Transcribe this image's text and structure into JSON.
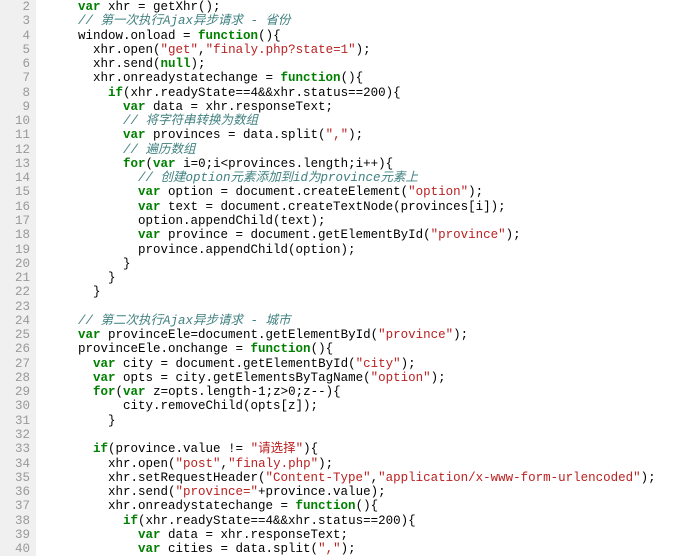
{
  "lines": [
    {
      "num": "2",
      "indent": 2,
      "tokens": [
        {
          "t": "var ",
          "c": "kw"
        },
        {
          "t": "xhr = getXhr();",
          "c": ""
        }
      ]
    },
    {
      "num": "3",
      "indent": 2,
      "tokens": [
        {
          "t": "// 第一次执行Ajax异步请求 - 省份",
          "c": "com"
        }
      ]
    },
    {
      "num": "4",
      "indent": 2,
      "tokens": [
        {
          "t": "window.onload = ",
          "c": ""
        },
        {
          "t": "function",
          "c": "kw"
        },
        {
          "t": "(){",
          "c": ""
        }
      ]
    },
    {
      "num": "5",
      "indent": 3,
      "tokens": [
        {
          "t": "xhr.open(",
          "c": ""
        },
        {
          "t": "\"get\"",
          "c": "str"
        },
        {
          "t": ",",
          "c": ""
        },
        {
          "t": "\"finaly.php?state=1\"",
          "c": "str"
        },
        {
          "t": ");",
          "c": ""
        }
      ]
    },
    {
      "num": "6",
      "indent": 3,
      "tokens": [
        {
          "t": "xhr.send(",
          "c": ""
        },
        {
          "t": "null",
          "c": "bool"
        },
        {
          "t": ");",
          "c": ""
        }
      ]
    },
    {
      "num": "7",
      "indent": 3,
      "tokens": [
        {
          "t": "xhr.onreadystatechange = ",
          "c": ""
        },
        {
          "t": "function",
          "c": "kw"
        },
        {
          "t": "(){",
          "c": ""
        }
      ]
    },
    {
      "num": "8",
      "indent": 4,
      "tokens": [
        {
          "t": "if",
          "c": "kw"
        },
        {
          "t": "(xhr.readyState==4&&xhr.status==200){",
          "c": ""
        }
      ]
    },
    {
      "num": "9",
      "indent": 5,
      "tokens": [
        {
          "t": "var ",
          "c": "kw"
        },
        {
          "t": "data = xhr.responseText;",
          "c": ""
        }
      ]
    },
    {
      "num": "10",
      "indent": 5,
      "tokens": [
        {
          "t": "// 将字符串转换为数组",
          "c": "com"
        }
      ]
    },
    {
      "num": "11",
      "indent": 5,
      "tokens": [
        {
          "t": "var ",
          "c": "kw"
        },
        {
          "t": "provinces = data.split(",
          "c": ""
        },
        {
          "t": "\",\"",
          "c": "str"
        },
        {
          "t": ");",
          "c": ""
        }
      ]
    },
    {
      "num": "12",
      "indent": 5,
      "tokens": [
        {
          "t": "// 遍历数组",
          "c": "com"
        }
      ]
    },
    {
      "num": "13",
      "indent": 5,
      "tokens": [
        {
          "t": "for",
          "c": "kw"
        },
        {
          "t": "(",
          "c": ""
        },
        {
          "t": "var ",
          "c": "kw"
        },
        {
          "t": "i=0;i<provinces.length;i++){",
          "c": ""
        }
      ]
    },
    {
      "num": "14",
      "indent": 6,
      "tokens": [
        {
          "t": "// 创建option元素添加到id为province元素上",
          "c": "com"
        }
      ]
    },
    {
      "num": "15",
      "indent": 6,
      "tokens": [
        {
          "t": "var ",
          "c": "kw"
        },
        {
          "t": "option = document.createElement(",
          "c": ""
        },
        {
          "t": "\"option\"",
          "c": "str"
        },
        {
          "t": ");",
          "c": ""
        }
      ]
    },
    {
      "num": "16",
      "indent": 6,
      "tokens": [
        {
          "t": "var ",
          "c": "kw"
        },
        {
          "t": "text = document.createTextNode(provinces[i]);",
          "c": ""
        }
      ]
    },
    {
      "num": "17",
      "indent": 6,
      "tokens": [
        {
          "t": "option.appendChild(text);",
          "c": ""
        }
      ]
    },
    {
      "num": "18",
      "indent": 6,
      "tokens": [
        {
          "t": "var ",
          "c": "kw"
        },
        {
          "t": "province = document.getElementById(",
          "c": ""
        },
        {
          "t": "\"province\"",
          "c": "str"
        },
        {
          "t": ");",
          "c": ""
        }
      ]
    },
    {
      "num": "19",
      "indent": 6,
      "tokens": [
        {
          "t": "province.appendChild(option);",
          "c": ""
        }
      ]
    },
    {
      "num": "20",
      "indent": 5,
      "tokens": [
        {
          "t": "}",
          "c": ""
        }
      ]
    },
    {
      "num": "21",
      "indent": 4,
      "tokens": [
        {
          "t": "}",
          "c": ""
        }
      ]
    },
    {
      "num": "22",
      "indent": 3,
      "tokens": [
        {
          "t": "}",
          "c": ""
        }
      ]
    },
    {
      "num": "23",
      "indent": 0,
      "tokens": []
    },
    {
      "num": "24",
      "indent": 2,
      "tokens": [
        {
          "t": "// 第二次执行Ajax异步请求 - 城市",
          "c": "com"
        }
      ]
    },
    {
      "num": "25",
      "indent": 2,
      "tokens": [
        {
          "t": "var ",
          "c": "kw"
        },
        {
          "t": "provinceEle=document.getElementById(",
          "c": ""
        },
        {
          "t": "\"province\"",
          "c": "str"
        },
        {
          "t": ");",
          "c": ""
        }
      ]
    },
    {
      "num": "26",
      "indent": 2,
      "tokens": [
        {
          "t": "provinceEle.onchange = ",
          "c": ""
        },
        {
          "t": "function",
          "c": "kw"
        },
        {
          "t": "(){",
          "c": ""
        }
      ]
    },
    {
      "num": "27",
      "indent": 3,
      "tokens": [
        {
          "t": "var ",
          "c": "kw"
        },
        {
          "t": "city = document.getElementById(",
          "c": ""
        },
        {
          "t": "\"city\"",
          "c": "str"
        },
        {
          "t": ");",
          "c": ""
        }
      ]
    },
    {
      "num": "28",
      "indent": 3,
      "tokens": [
        {
          "t": "var ",
          "c": "kw"
        },
        {
          "t": "opts = city.getElementsByTagName(",
          "c": ""
        },
        {
          "t": "\"option\"",
          "c": "str"
        },
        {
          "t": ");",
          "c": ""
        }
      ]
    },
    {
      "num": "29",
      "indent": 3,
      "tokens": [
        {
          "t": "for",
          "c": "kw"
        },
        {
          "t": "(",
          "c": ""
        },
        {
          "t": "var ",
          "c": "kw"
        },
        {
          "t": "z=opts.length-1;z>0;z--){",
          "c": ""
        }
      ]
    },
    {
      "num": "30",
      "indent": 5,
      "tokens": [
        {
          "t": "city.removeChild(opts[z]);",
          "c": ""
        }
      ]
    },
    {
      "num": "31",
      "indent": 4,
      "tokens": [
        {
          "t": "}",
          "c": ""
        }
      ]
    },
    {
      "num": "32",
      "indent": 0,
      "tokens": []
    },
    {
      "num": "33",
      "indent": 3,
      "tokens": [
        {
          "t": "if",
          "c": "kw"
        },
        {
          "t": "(province.value != ",
          "c": ""
        },
        {
          "t": "\"请选择\"",
          "c": "str"
        },
        {
          "t": "){",
          "c": ""
        }
      ]
    },
    {
      "num": "34",
      "indent": 4,
      "tokens": [
        {
          "t": "xhr.open(",
          "c": ""
        },
        {
          "t": "\"post\"",
          "c": "str"
        },
        {
          "t": ",",
          "c": ""
        },
        {
          "t": "\"finaly.php\"",
          "c": "str"
        },
        {
          "t": ");",
          "c": ""
        }
      ]
    },
    {
      "num": "35",
      "indent": 4,
      "tokens": [
        {
          "t": "xhr.setRequestHeader(",
          "c": ""
        },
        {
          "t": "\"Content-Type\"",
          "c": "str"
        },
        {
          "t": ",",
          "c": ""
        },
        {
          "t": "\"application/x-www-form-urlencoded\"",
          "c": "str"
        },
        {
          "t": ");",
          "c": ""
        }
      ]
    },
    {
      "num": "36",
      "indent": 4,
      "tokens": [
        {
          "t": "xhr.send(",
          "c": ""
        },
        {
          "t": "\"province=\"",
          "c": "str"
        },
        {
          "t": "+province.value);",
          "c": ""
        }
      ]
    },
    {
      "num": "37",
      "indent": 4,
      "tokens": [
        {
          "t": "xhr.onreadystatechange = ",
          "c": ""
        },
        {
          "t": "function",
          "c": "kw"
        },
        {
          "t": "(){",
          "c": ""
        }
      ]
    },
    {
      "num": "38",
      "indent": 5,
      "tokens": [
        {
          "t": "if",
          "c": "kw"
        },
        {
          "t": "(xhr.readyState==4&&xhr.status==200){",
          "c": ""
        }
      ]
    },
    {
      "num": "39",
      "indent": 6,
      "tokens": [
        {
          "t": "var ",
          "c": "kw"
        },
        {
          "t": "data = xhr.responseText;",
          "c": ""
        }
      ]
    },
    {
      "num": "40",
      "indent": 6,
      "tokens": [
        {
          "t": "var ",
          "c": "kw"
        },
        {
          "t": "cities = data.split(",
          "c": ""
        },
        {
          "t": "\",\"",
          "c": "str"
        },
        {
          "t": ");",
          "c": ""
        }
      ]
    }
  ]
}
